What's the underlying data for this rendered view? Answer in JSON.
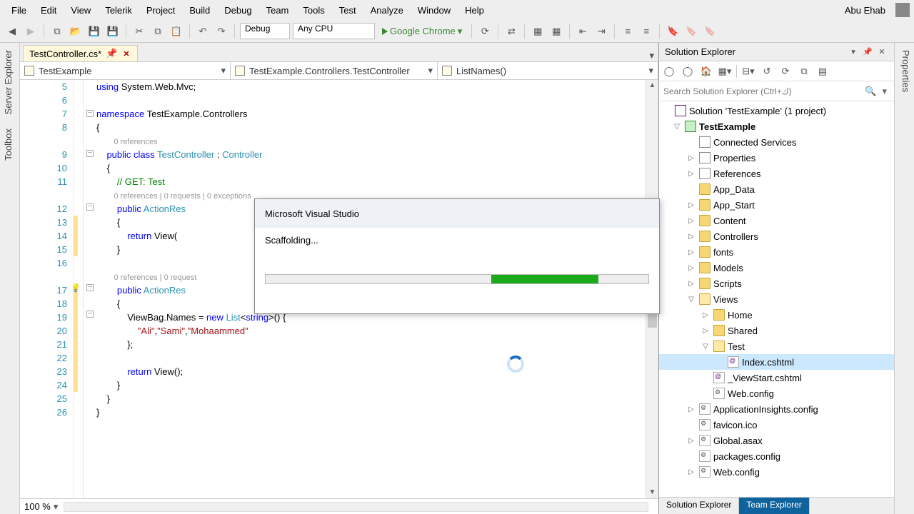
{
  "menu": [
    "File",
    "Edit",
    "View",
    "Telerik",
    "Project",
    "Build",
    "Debug",
    "Team",
    "Tools",
    "Test",
    "Analyze",
    "Window",
    "Help"
  ],
  "user": "Abu Ehab",
  "toolbar": {
    "config": "Debug",
    "platform": "Any CPU",
    "browser": "Google Chrome"
  },
  "editor": {
    "tab": "TestController.cs*",
    "nav": {
      "project": "TestExample",
      "class": "TestExample.Controllers.TestController",
      "member": "ListNames()"
    },
    "zoom": "100 %",
    "lines": {
      "5": {
        "t": "using System.Web.Mvc;",
        "seg": [
          [
            "kw",
            "using"
          ],
          [
            "",
            " System.Web.Mvc;"
          ]
        ]
      },
      "6": {
        "t": ""
      },
      "7": {
        "seg": [
          [
            "kw",
            "namespace"
          ],
          [
            "",
            " TestExample.Controllers"
          ]
        ]
      },
      "8": {
        "t": "{"
      },
      "8m": {
        "t": "0 references",
        "meta": true,
        "indent": "        "
      },
      "9": {
        "seg": [
          [
            "",
            "    "
          ],
          [
            "kw",
            "public class"
          ],
          [
            "",
            " "
          ],
          [
            "typ",
            "TestController"
          ],
          [
            "",
            " : "
          ],
          [
            "typ",
            "Controller"
          ]
        ]
      },
      "10": {
        "t": "    {"
      },
      "11": {
        "seg": [
          [
            "",
            "        "
          ],
          [
            "com",
            "// GET: Test"
          ]
        ]
      },
      "11m": {
        "t": "0 references | 0 requests | 0 exceptions",
        "meta": true,
        "indent": "        "
      },
      "12": {
        "seg": [
          [
            "",
            "        "
          ],
          [
            "kw",
            "public"
          ],
          [
            "",
            " "
          ],
          [
            "typ",
            "ActionRes"
          ]
        ]
      },
      "13": {
        "t": "        {"
      },
      "14": {
        "seg": [
          [
            "",
            "            "
          ],
          [
            "kw",
            "return"
          ],
          [
            "",
            " View("
          ]
        ]
      },
      "15": {
        "t": "        }"
      },
      "16": {
        "t": ""
      },
      "16m": {
        "t": "0 references | 0 request",
        "meta": true,
        "indent": "        "
      },
      "17": {
        "seg": [
          [
            "",
            "        "
          ],
          [
            "kw",
            "public"
          ],
          [
            "",
            " "
          ],
          [
            "typ",
            "ActionRes"
          ]
        ]
      },
      "18": {
        "t": "        {"
      },
      "19": {
        "seg": [
          [
            "",
            "            ViewBag.Names = "
          ],
          [
            "kw",
            "new"
          ],
          [
            "",
            " "
          ],
          [
            "typ",
            "List"
          ],
          [
            "",
            "<"
          ],
          [
            "kw",
            "string"
          ],
          [
            "",
            ">() {"
          ]
        ]
      },
      "20": {
        "seg": [
          [
            "",
            "                "
          ],
          [
            "str",
            "\"Ali\""
          ],
          [
            "",
            ","
          ],
          [
            "str",
            "\"Sami\""
          ],
          [
            "",
            ","
          ],
          [
            "str",
            "\"Mohaammed\""
          ]
        ]
      },
      "21": {
        "t": "            };"
      },
      "22": {
        "t": ""
      },
      "23": {
        "seg": [
          [
            "",
            "            "
          ],
          [
            "kw",
            "return"
          ],
          [
            "",
            " View();"
          ]
        ]
      },
      "24": {
        "t": "        }"
      },
      "25": {
        "t": "    }"
      },
      "26": {
        "t": "}"
      }
    }
  },
  "solexp": {
    "title": "Solution Explorer",
    "search_placeholder": "Search Solution Explorer (Ctrl+ك)",
    "solution": "Solution 'TestExample' (1 project)",
    "project": "TestExample",
    "nodes": [
      {
        "d": 1,
        "label": "Connected Services",
        "ico": "ref"
      },
      {
        "d": 1,
        "label": "Properties",
        "ico": "ref",
        "exp": "▷"
      },
      {
        "d": 1,
        "label": "References",
        "ico": "ref",
        "exp": "▷"
      },
      {
        "d": 1,
        "label": "App_Data",
        "ico": "folder"
      },
      {
        "d": 1,
        "label": "App_Start",
        "ico": "folder",
        "exp": "▷"
      },
      {
        "d": 1,
        "label": "Content",
        "ico": "folder",
        "exp": "▷"
      },
      {
        "d": 1,
        "label": "Controllers",
        "ico": "folder",
        "exp": "▷"
      },
      {
        "d": 1,
        "label": "fonts",
        "ico": "folder",
        "exp": "▷"
      },
      {
        "d": 1,
        "label": "Models",
        "ico": "folder",
        "exp": "▷"
      },
      {
        "d": 1,
        "label": "Scripts",
        "ico": "folder",
        "exp": "▷"
      },
      {
        "d": 1,
        "label": "Views",
        "ico": "folder open",
        "exp": "▽"
      },
      {
        "d": 2,
        "label": "Home",
        "ico": "folder",
        "exp": "▷"
      },
      {
        "d": 2,
        "label": "Shared",
        "ico": "folder",
        "exp": "▷"
      },
      {
        "d": 2,
        "label": "Test",
        "ico": "folder open",
        "exp": "▽"
      },
      {
        "d": 3,
        "label": "Index.cshtml",
        "ico": "csfile",
        "sel": true
      },
      {
        "d": 2,
        "label": "_ViewStart.cshtml",
        "ico": "csfile"
      },
      {
        "d": 2,
        "label": "Web.config",
        "ico": "cfg"
      },
      {
        "d": 1,
        "label": "ApplicationInsights.config",
        "ico": "cfg",
        "exp": "▷"
      },
      {
        "d": 1,
        "label": "favicon.ico",
        "ico": "cfg"
      },
      {
        "d": 1,
        "label": "Global.asax",
        "ico": "cfg",
        "exp": "▷"
      },
      {
        "d": 1,
        "label": "packages.config",
        "ico": "cfg"
      },
      {
        "d": 1,
        "label": "Web.config",
        "ico": "cfg",
        "exp": "▷"
      }
    ],
    "bottom_tabs": [
      "Solution Explorer",
      "Team Explorer"
    ]
  },
  "modal": {
    "title": "Microsoft Visual Studio",
    "msg": "Scaffolding..."
  },
  "sidetabs": {
    "left": [
      "Server Explorer",
      "Toolbox"
    ],
    "right": [
      "Properties"
    ]
  }
}
